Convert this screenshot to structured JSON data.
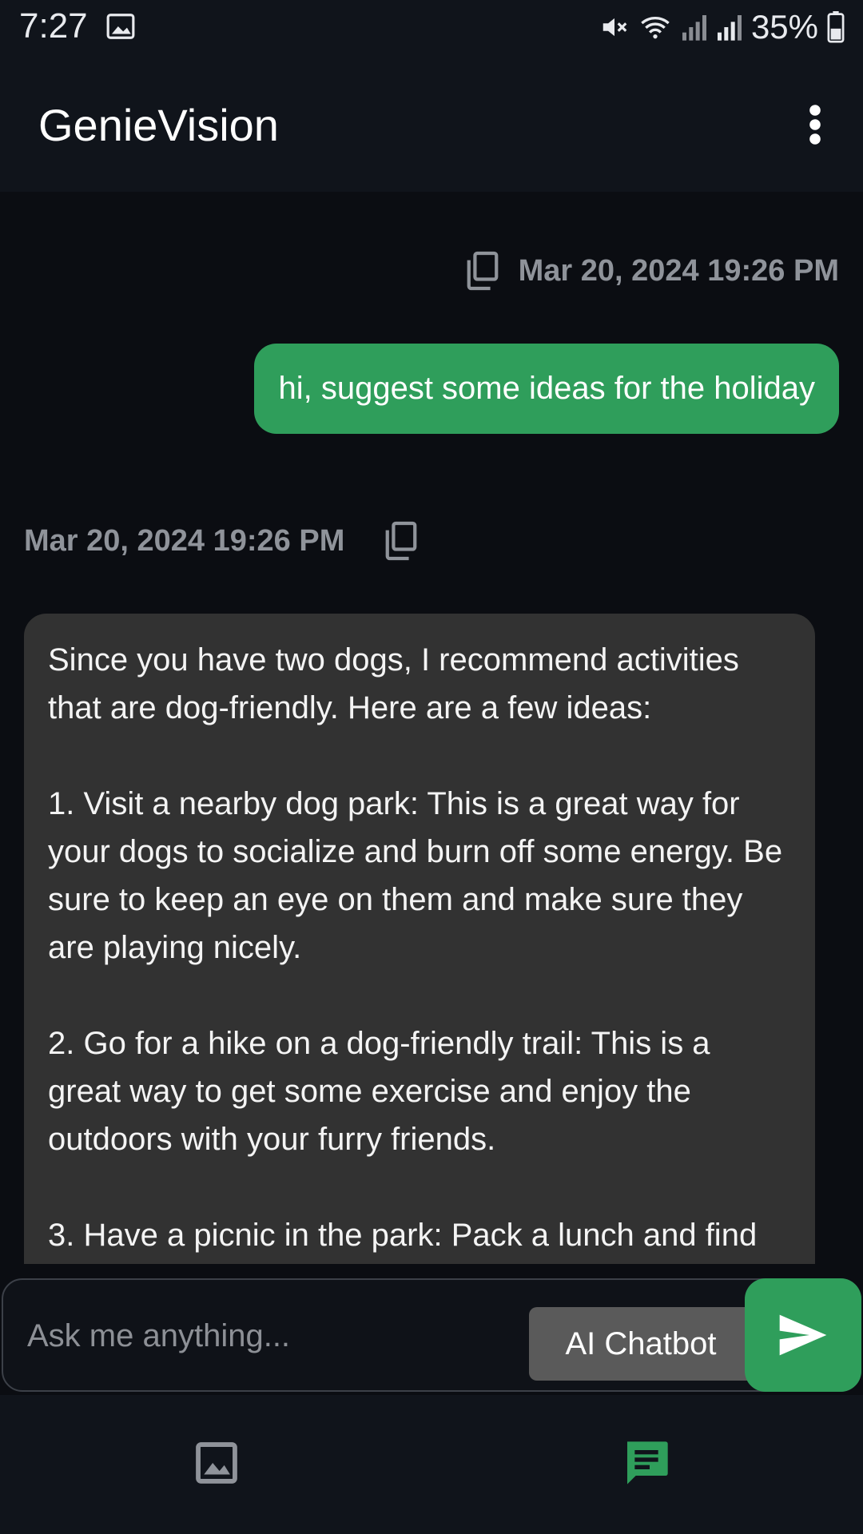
{
  "status_bar": {
    "time": "7:27",
    "battery": "35%"
  },
  "app_bar": {
    "title": "GenieVision"
  },
  "messages": [
    {
      "role": "user",
      "timestamp": "Mar 20, 2024 19:26 PM",
      "text": "hi, suggest some ideas for the holiday"
    },
    {
      "role": "bot",
      "timestamp": "Mar 20, 2024 19:26 PM",
      "text": "Since you have two dogs, I recommend activities that are dog-friendly. Here are a few ideas:\n\n1. Visit a nearby dog park: This is a great way for your dogs to socialize and burn off some energy. Be sure to keep an eye on them and make sure they are playing nicely.\n\n2. Go for a hike on a dog-friendly trail: This is a great way to get some exercise and enjoy the outdoors with your furry friends.\n\n3. Have a picnic in the park: Pack a lunch and find"
    }
  ],
  "composer": {
    "placeholder": "Ask me anything...",
    "mode_label": "AI Chatbot"
  },
  "colors": {
    "accent": "#2f9e5b",
    "background": "#0b0d12",
    "bot_bubble": "#323232"
  }
}
